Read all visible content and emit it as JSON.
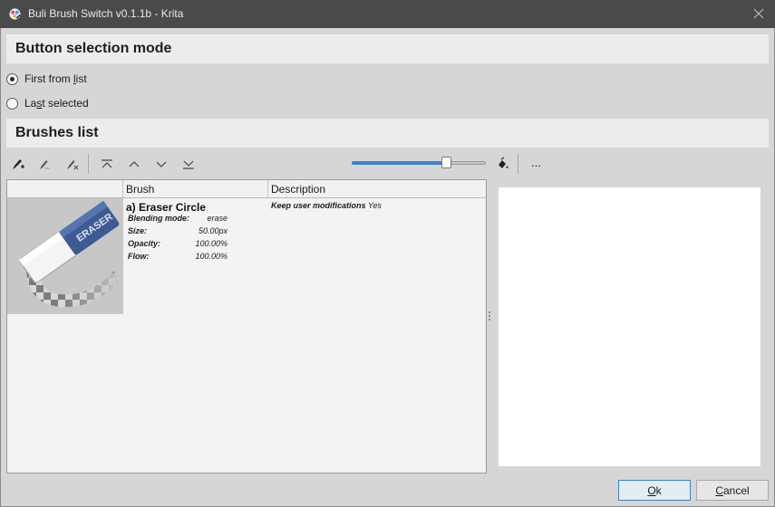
{
  "window": {
    "title": "Buli Brush Switch v0.1.1b - Krita",
    "icons": {
      "app": "krita-icon",
      "close": "close-icon"
    }
  },
  "mode_section": {
    "title": "Button selection mode",
    "options": [
      {
        "label_pre": "First from ",
        "label_key": "l",
        "label_post": "ist",
        "checked": true
      },
      {
        "label_pre": "La",
        "label_key": "s",
        "label_post": "t selected",
        "checked": false
      }
    ]
  },
  "brushes_section": {
    "title": "Brushes list"
  },
  "toolbar": {
    "icons": [
      "add-brush-icon",
      "edit-brush-icon",
      "remove-brush-icon",
      "move-first-icon",
      "move-up-icon",
      "move-down-icon",
      "move-last-icon",
      "paint-bucket-icon"
    ],
    "zoom_level": 0.72,
    "more_label": "..."
  },
  "table": {
    "columns": [
      "",
      "Brush",
      "Description"
    ],
    "rows": [
      {
        "thumbnail": "eraser-icon",
        "thumbnail_text": "ERASER",
        "name": "a) Eraser Circle",
        "props": [
          {
            "key": "Blending mode:",
            "value": "erase"
          },
          {
            "key": "Size:",
            "value": "50.00px"
          },
          {
            "key": "Opacity:",
            "value": "100.00%"
          },
          {
            "key": "Flow:",
            "value": "100.00%"
          }
        ],
        "description_key": "Keep user modifications",
        "description_value": "Yes"
      }
    ]
  },
  "buttons": {
    "ok_key": "O",
    "ok_rest": "k",
    "cancel_key": "C",
    "cancel_rest": "ancel"
  },
  "colors": {
    "accent": "#3c83c9",
    "titlebar": "#4a4a4a",
    "panel": "#d6d6d6",
    "header": "#ececec"
  }
}
